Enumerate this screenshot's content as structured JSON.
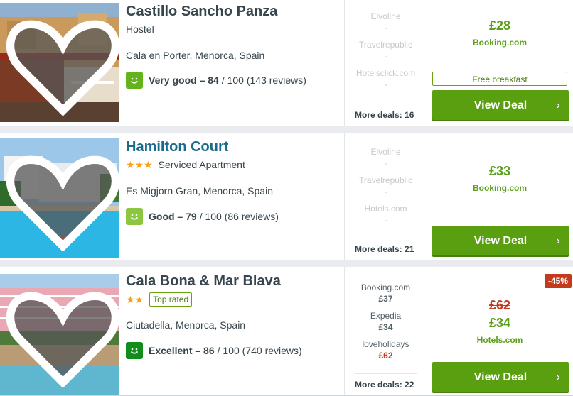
{
  "listings": [
    {
      "name": "Castillo Sancho Panza",
      "type": "Hostel",
      "location": "Cala en Porter, Menorca, Spain",
      "rating_label": "Very good – 84",
      "rating_rest": "/ 100 (143 reviews)",
      "deals": [
        {
          "provider": "Elvoline",
          "price": "-"
        },
        {
          "provider": "Travelrepublic",
          "price": "-"
        },
        {
          "provider": "Hotelsclick.com",
          "price": "-"
        }
      ],
      "more_deals": "More deals: 16",
      "price": "£28",
      "price_site": "Booking.com",
      "perk": "Free breakfast",
      "cta": "View Deal"
    },
    {
      "name": "Hamilton Court",
      "stars": "★★★",
      "type": "Serviced Apartment",
      "location": "Es Migjorn Gran, Menorca, Spain",
      "rating_label": "Good – 79",
      "rating_rest": "/ 100 (86 reviews)",
      "deals": [
        {
          "provider": "Elvoline",
          "price": "-"
        },
        {
          "provider": "Travelrepublic",
          "price": "-"
        },
        {
          "provider": "Hotels.com",
          "price": "-"
        }
      ],
      "more_deals": "More deals: 21",
      "price": "£33",
      "price_site": "Booking.com",
      "cta": "View Deal"
    },
    {
      "name": "Cala Bona & Mar Blava",
      "stars": "★★",
      "badge_label": "Top rated",
      "location": "Ciutadella, Menorca, Spain",
      "rating_label": "Excellent – 86",
      "rating_rest": "/ 100 (740 reviews)",
      "deals": [
        {
          "provider": "Booking.com",
          "price": "£37"
        },
        {
          "provider": "Expedia",
          "price": "£34"
        },
        {
          "provider": "loveholidays",
          "price": "£62"
        }
      ],
      "more_deals": "More deals: 22",
      "old_price": "£62",
      "price": "£34",
      "price_site": "Hotels.com",
      "discount": "-45%",
      "cta": "View Deal"
    }
  ],
  "icons": {
    "favorite": "heart-icon",
    "rating": "smiley-icon",
    "cta": "chevron-right-icon"
  },
  "colors": {
    "accent": "#5a9f10",
    "discount": "#c33b1f",
    "title_link": "#1a6a8a"
  }
}
